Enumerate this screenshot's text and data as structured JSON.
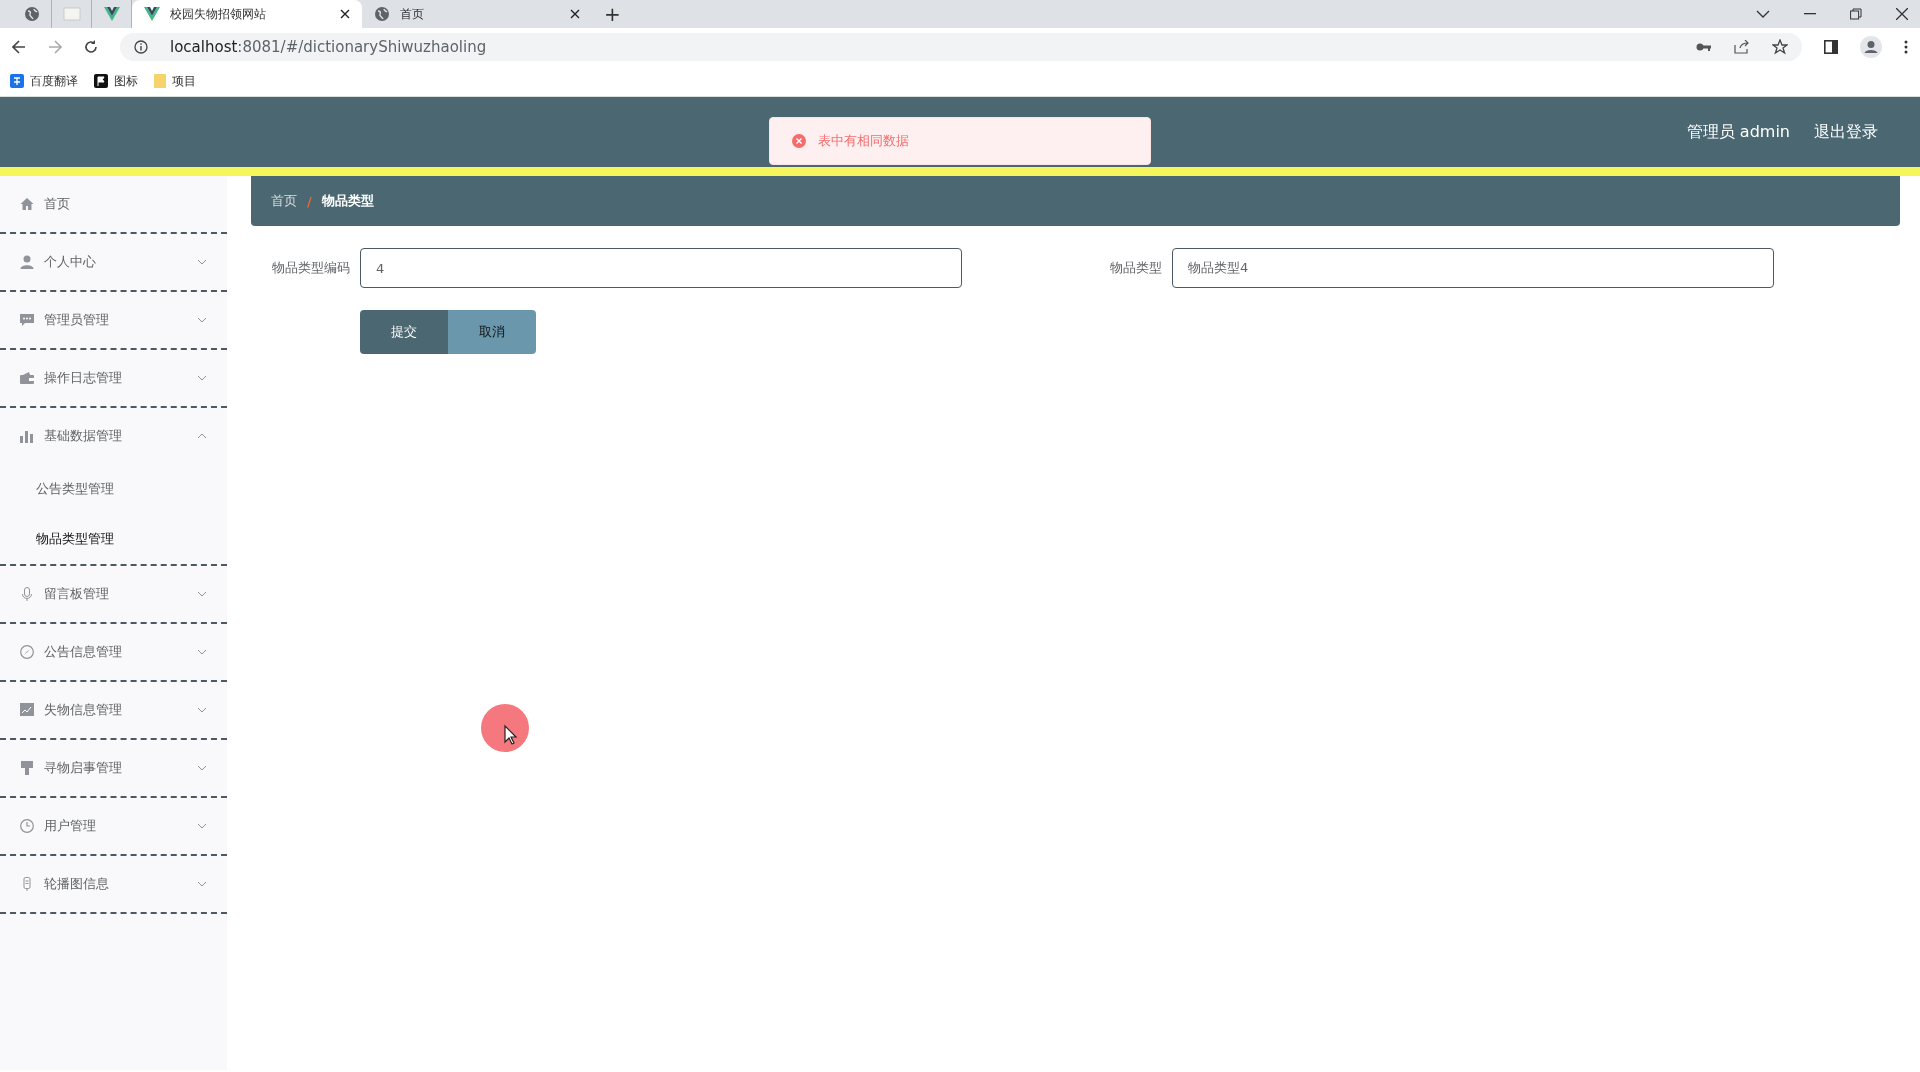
{
  "browser": {
    "tabs": [
      {
        "kind": "pinned",
        "selected": false
      },
      {
        "kind": "pinned",
        "selected": false
      },
      {
        "kind": "pinned",
        "selected": false
      },
      {
        "kind": "page",
        "title": "校园失物招领网站",
        "selected": true
      },
      {
        "kind": "page",
        "title": "首页",
        "selected": false
      }
    ],
    "new_tab": "+",
    "address": {
      "host": "localhost",
      "rest": ":8081/#/dictionaryShiwuzhaoling"
    },
    "bookmarks": [
      "百度翻译",
      "图标",
      "项目"
    ]
  },
  "header": {
    "user": "管理员 admin",
    "logout": "退出登录"
  },
  "toast": {
    "message": "表中有相同数据"
  },
  "sidebar": {
    "items": [
      {
        "kind": "link",
        "label": "首页"
      },
      {
        "kind": "menu",
        "label": "个人中心",
        "expanded": false
      },
      {
        "kind": "menu",
        "label": "管理员管理",
        "expanded": false
      },
      {
        "kind": "menu",
        "label": "操作日志管理",
        "expanded": false
      },
      {
        "kind": "menu",
        "label": "基础数据管理",
        "expanded": true,
        "children": [
          {
            "label": "公告类型管理",
            "selected": false
          },
          {
            "label": "物品类型管理",
            "selected": true
          }
        ]
      },
      {
        "kind": "menu",
        "label": "留言板管理",
        "expanded": false
      },
      {
        "kind": "menu",
        "label": "公告信息管理",
        "expanded": false
      },
      {
        "kind": "menu",
        "label": "失物信息管理",
        "expanded": false
      },
      {
        "kind": "menu",
        "label": "寻物启事管理",
        "expanded": false
      },
      {
        "kind": "menu",
        "label": "用户管理",
        "expanded": false
      },
      {
        "kind": "menu",
        "label": "轮播图信息",
        "expanded": false
      }
    ]
  },
  "breadcrumb": {
    "items": [
      "首页",
      "物品类型"
    ],
    "separator": "/"
  },
  "form": {
    "fields": [
      {
        "label": "物品类型编码",
        "value": "4"
      },
      {
        "label": "物品类型",
        "value": "物品类型4"
      }
    ],
    "buttons": [
      {
        "kind": "primary",
        "label": "提交"
      },
      {
        "kind": "secondary",
        "label": "取消"
      }
    ]
  }
}
